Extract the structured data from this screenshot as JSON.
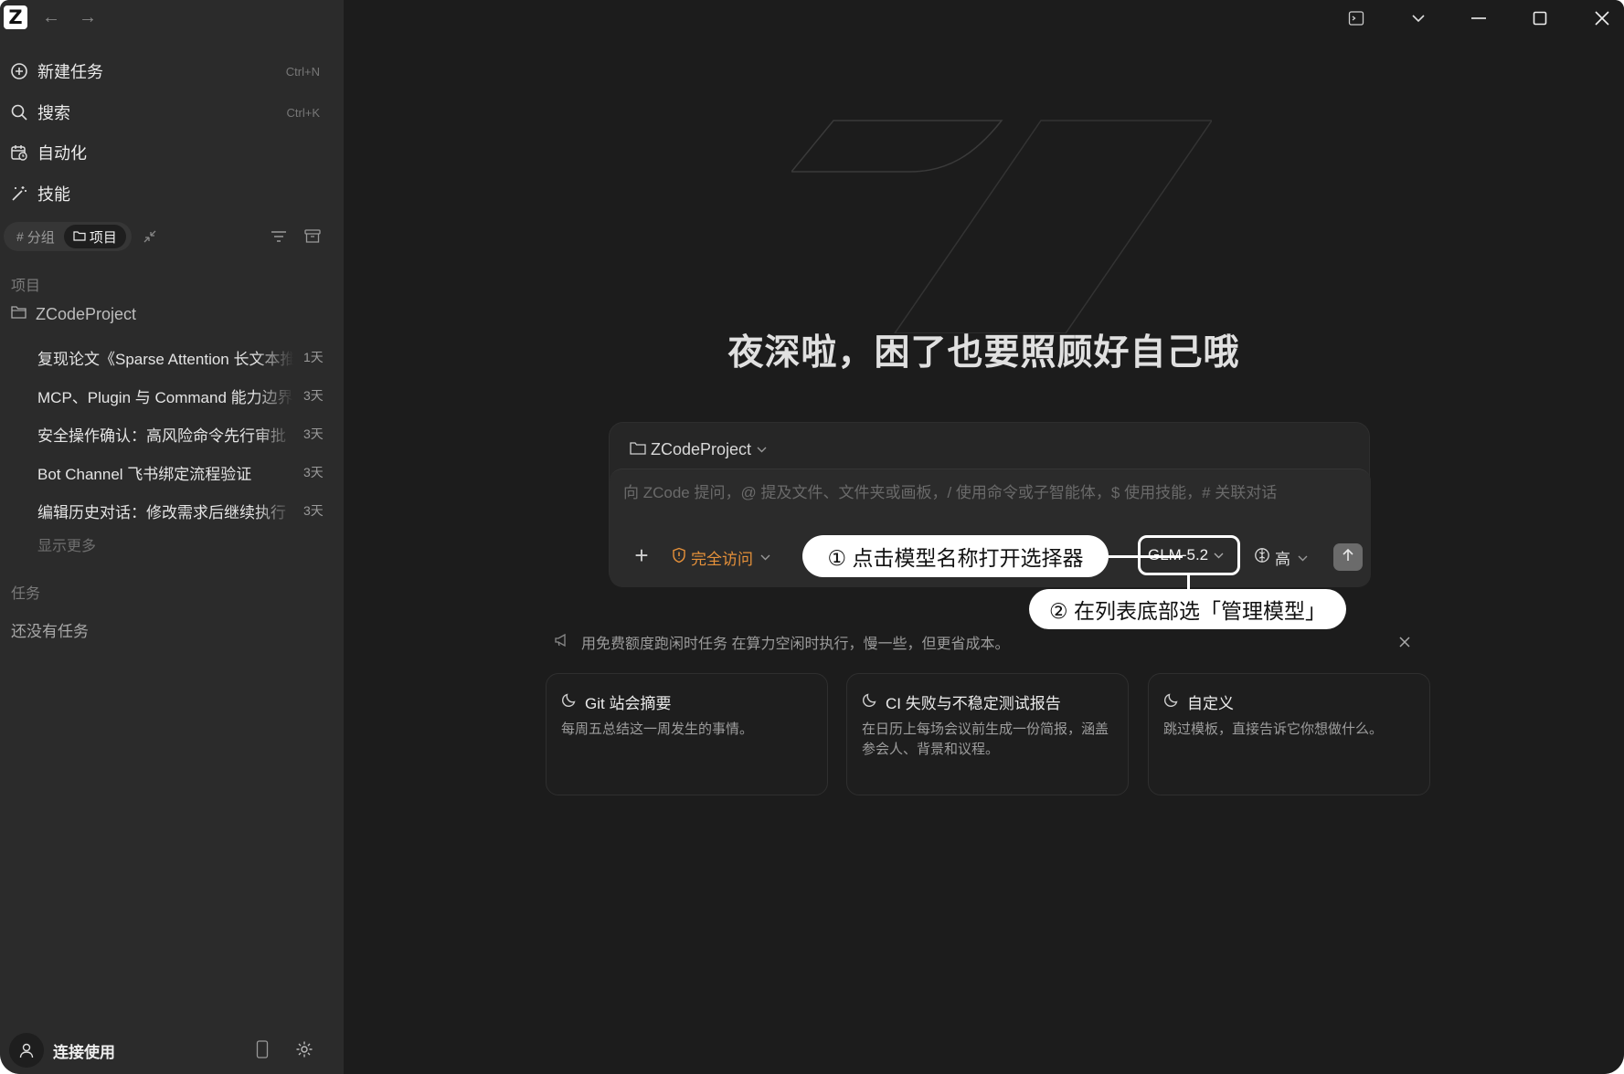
{
  "app": {
    "logo_letter": "Z"
  },
  "sidebar": {
    "nav_back": "←",
    "nav_forward": "→",
    "menu": [
      {
        "label": "新建任务",
        "shortcut": "Ctrl+N",
        "icon": "plus-circle-icon"
      },
      {
        "label": "搜索",
        "shortcut": "Ctrl+K",
        "icon": "search-icon"
      },
      {
        "label": "自动化",
        "shortcut": "",
        "icon": "calendar-clock-icon"
      },
      {
        "label": "技能",
        "shortcut": "",
        "icon": "magic-wand-icon"
      }
    ],
    "segments": [
      {
        "label": "分组",
        "icon": "#",
        "active": false
      },
      {
        "label": "项目",
        "icon": "folder-icon",
        "active": true
      }
    ],
    "projects_header": "项目",
    "project": "ZCodeProject",
    "threads": [
      {
        "title": "复现论文《Sparse Attention 长文本推理》",
        "age": "1天"
      },
      {
        "title": "MCP、Plugin 与 Command 能力边界",
        "age": "3天"
      },
      {
        "title": "安全操作确认：高风险命令先行审批",
        "age": "3天"
      },
      {
        "title": "Bot Channel 飞书绑定流程验证",
        "age": "3天"
      },
      {
        "title": "编辑历史对话：修改需求后继续执行",
        "age": "3天"
      }
    ],
    "show_more": "显示更多",
    "tasks_header": "任务",
    "tasks_empty": "还没有任务",
    "user_label": "连接使用"
  },
  "main": {
    "greeting": "夜深啦，困了也要照顾好自己哦",
    "composer": {
      "project": "ZCodeProject",
      "placeholder": "向 ZCode 提问，@ 提及文件、文件夹或画板，/ 使用命令或子智能体，$ 使用技能，# 关联对话",
      "plus": "+",
      "access": "完全访问",
      "model": "GLM-5.2",
      "effort": "高"
    },
    "callouts": {
      "one": "① 点击模型名称打开选择器",
      "two": "② 在列表底部选「管理模型」"
    },
    "notice": "用免费额度跑闲时任务 在算力空闲时执行，慢一些，但更省成本。",
    "cards": [
      {
        "title": "Git 站会摘要",
        "desc": "每周五总结这一周发生的事情。"
      },
      {
        "title": "CI 失败与不稳定测试报告",
        "desc": "在日历上每场会议前生成一份简报，涵盖参会人、背景和议程。"
      },
      {
        "title": "自定义",
        "desc": "跳过模板，直接告诉它你想做什么。"
      }
    ]
  },
  "colors": {
    "sidebar_bg": "#2b2b2b",
    "main_bg": "#1c1c1c",
    "accent_orange": "#e6913a",
    "callout_bg": "#ffffff"
  }
}
